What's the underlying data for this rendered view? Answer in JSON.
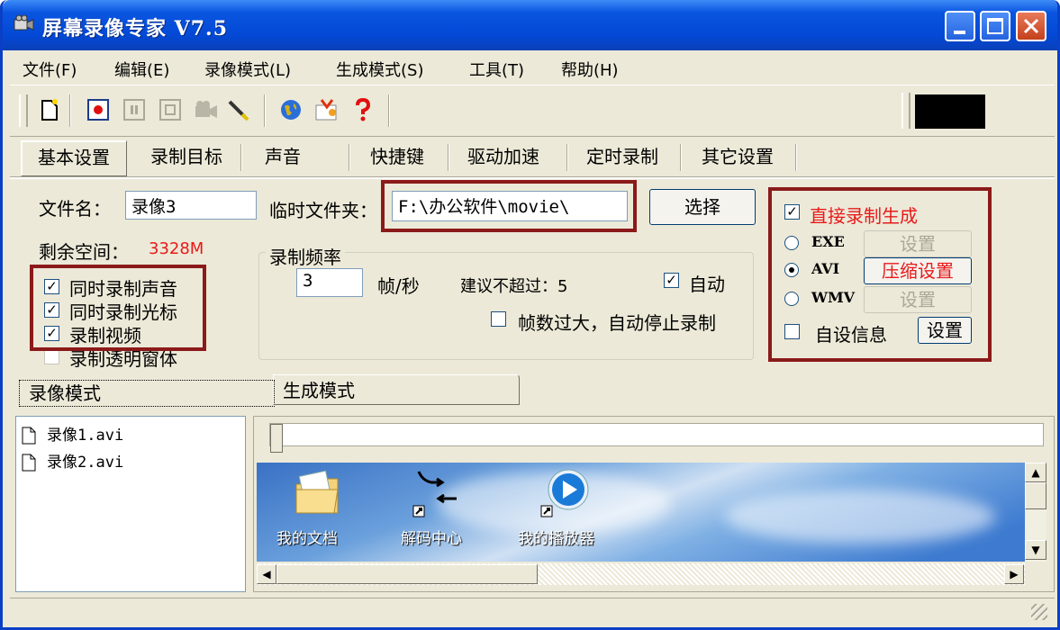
{
  "window": {
    "title": "屏幕录像专家 V7.5"
  },
  "menu": [
    "文件(F)",
    "编辑(E)",
    "录像模式(L)",
    "生成模式(S)",
    "工具(T)",
    "帮助(H)"
  ],
  "toolbar": {
    "icons": [
      "new-file-icon",
      "record-icon",
      "pause-icon",
      "stop-icon",
      "camera-icon",
      "pen-icon",
      "globe-icon",
      "tools-icon",
      "help-icon"
    ]
  },
  "tabs": [
    "基本设置",
    "录制目标",
    "声音",
    "快捷键",
    "驱动加速",
    "定时录制",
    "其它设置"
  ],
  "basic": {
    "filename_label": "文件名：",
    "filename_value": "录像3",
    "temp_folder_label": "临时文件夹：",
    "temp_folder_value": "F:\\办公软件\\movie\\",
    "choose_button": "选择",
    "free_space_label": "剩余空间：",
    "free_space_value": "3328M",
    "options": [
      {
        "label": "同时录制声音",
        "checked": true
      },
      {
        "label": "同时录制光标",
        "checked": true
      },
      {
        "label": "录制视频",
        "checked": true
      },
      {
        "label": "录制透明窗体",
        "checked": false
      }
    ],
    "frame_rate": {
      "group_label": "录制频率",
      "value": "3",
      "unit": "帧/秒",
      "suggest": "建议不超过：5",
      "auto_label": "自动",
      "auto_checked": true,
      "stop_label": "帧数过大，自动停止录制",
      "stop_checked": false
    },
    "output": {
      "direct_label": "直接录制生成",
      "direct_checked": true,
      "formats": [
        {
          "label": "EXE",
          "selected": false,
          "button": "设置",
          "button_enabled": false
        },
        {
          "label": "AVI",
          "selected": true,
          "button": "压缩设置",
          "button_enabled": true
        },
        {
          "label": "WMV",
          "selected": false,
          "button": "设置",
          "button_enabled": false
        }
      ],
      "custom_info_label": "自设信息",
      "custom_info_checked": false,
      "custom_info_button": "设置"
    }
  },
  "bottom_tabs": [
    "录像模式",
    "生成模式"
  ],
  "files": [
    "录像1.avi",
    "录像2.avi"
  ],
  "desktop_icons": [
    "我的文档",
    "解码中心",
    "我的播放器"
  ],
  "colors": {
    "titlebar": "#0349d6",
    "highlight_frame": "#8b1a1a",
    "red_text": "#e81a1a",
    "window_bg": "#ece9d8"
  }
}
